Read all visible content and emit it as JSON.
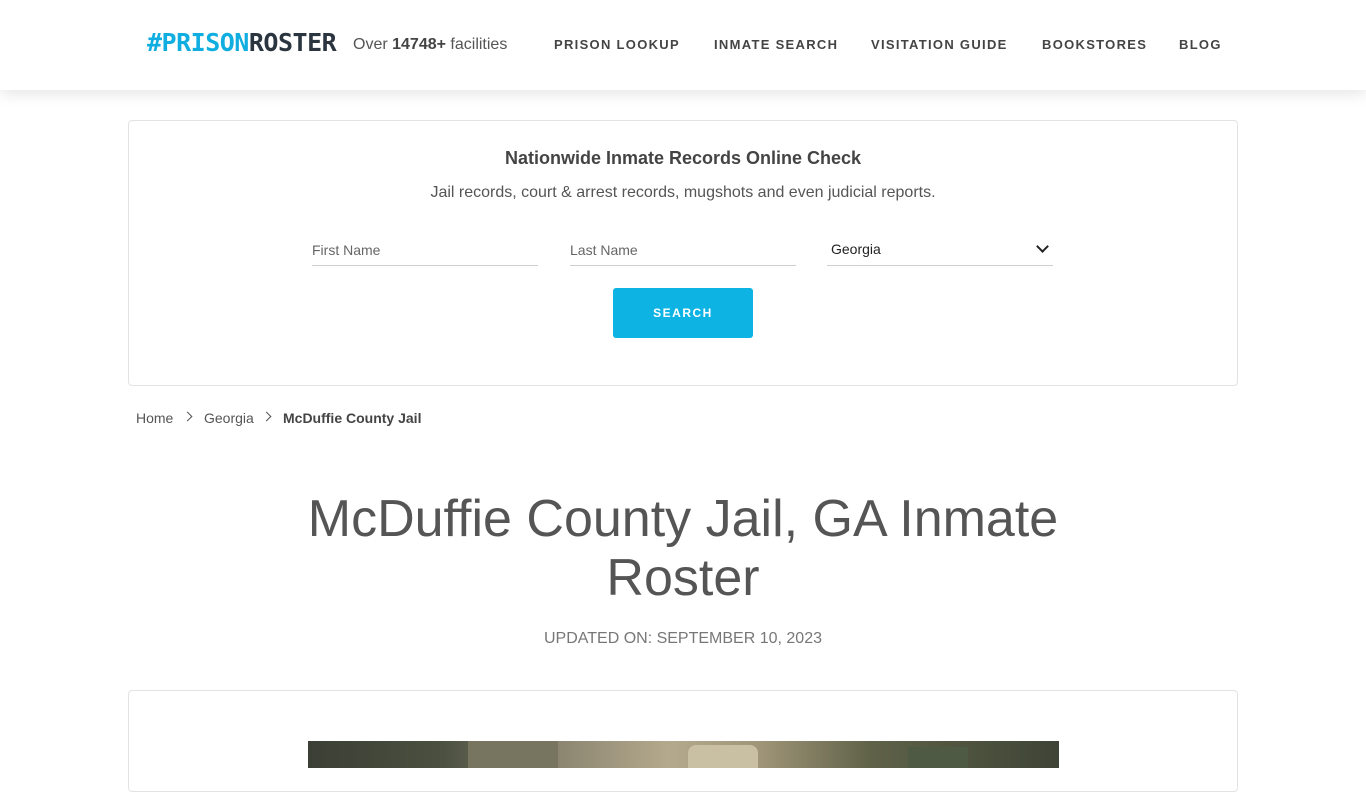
{
  "header": {
    "logo_part1": "#PRISON",
    "logo_part2": "ROSTER",
    "facilities_prefix": "Over ",
    "facilities_count": "14748+",
    "facilities_suffix": " facilities",
    "nav": [
      "PRISON LOOKUP",
      "INMATE SEARCH",
      "VISITATION GUIDE",
      "BOOKSTORES",
      "BLOG"
    ]
  },
  "search": {
    "title": "Nationwide Inmate Records Online Check",
    "subtitle": "Jail records, court & arrest records, mugshots and even judicial reports.",
    "first_name_placeholder": "First Name",
    "last_name_placeholder": "Last Name",
    "state_selected": "Georgia",
    "button_label": "SEARCH"
  },
  "breadcrumb": {
    "home": "Home",
    "state": "Georgia",
    "current": "McDuffie County Jail"
  },
  "page": {
    "title": "McDuffie County Jail, GA Inmate Roster",
    "updated": "UPDATED ON: SEPTEMBER 10, 2023"
  },
  "colors": {
    "accent": "#0db4e3",
    "logo_dark": "#2a3540",
    "text": "#555555"
  }
}
